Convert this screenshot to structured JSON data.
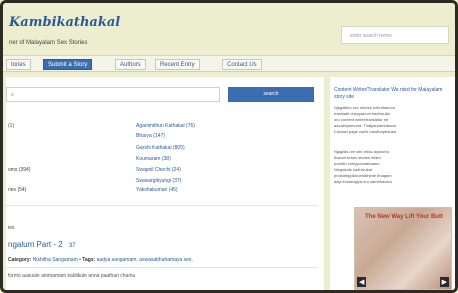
{
  "header": {
    "logo_text": "Kambikathakal",
    "tagline": "ner of Malayalam Sex Stories",
    "search_placeholder": "enter search terms"
  },
  "nav": {
    "items": [
      "tories",
      "Submit a Story",
      "Authors",
      "Recent Entry",
      "Contact Us"
    ],
    "active_index": 1
  },
  "main": {
    "search_placeholder": "s",
    "search_button": "search",
    "categories_left": [
      "(1)",
      "",
      "",
      "oms (394)",
      "ries (54)"
    ],
    "categories_right": [
      "Aganimithun Kathakal (76)",
      "Bharya (147)",
      "Garshi Kathakal (805)",
      "Koumaram (38)",
      "Swapnil Chechi (24)",
      "Swavargikyungi (37)",
      "Yakshakumari (45)"
    ],
    "section_label": "ies",
    "post": {
      "title": "ngalum Part - 2",
      "title_suffix": "37",
      "category_label": "Category:",
      "category_value": "Nishitha Sangamam",
      "tags_label": "Tags:",
      "tags_value": "aadya sangamam, aswasabhahamaya sex,",
      "excerpt": "formo aasuale ammamam kaldikule anna paathari chamu"
    }
  },
  "sidebar": {
    "title": "Content Writer/Translator Wa nted for Malayalam story site",
    "lines": [
      "Njagalkku sex stories ezhuthanum",
      "translate cheyyanum kazhivulla",
      "oru content writer/translator ne",
      "aavashyamund. Thalparyamullavar",
      "Contact page vazhi bandhapeduka.",
      "",
      "Njagalku ee site lekku ayacchu",
      "tharunna sex stories ellam",
      "publish cheyyunnathaanu.",
      "Ningalude kazhivukal",
      "prolsahippikkunnathinte bhagam",
      "aayi thodangiya oru sambhavam"
    ],
    "ad_text": "The New Way Lift Your Butt"
  }
}
